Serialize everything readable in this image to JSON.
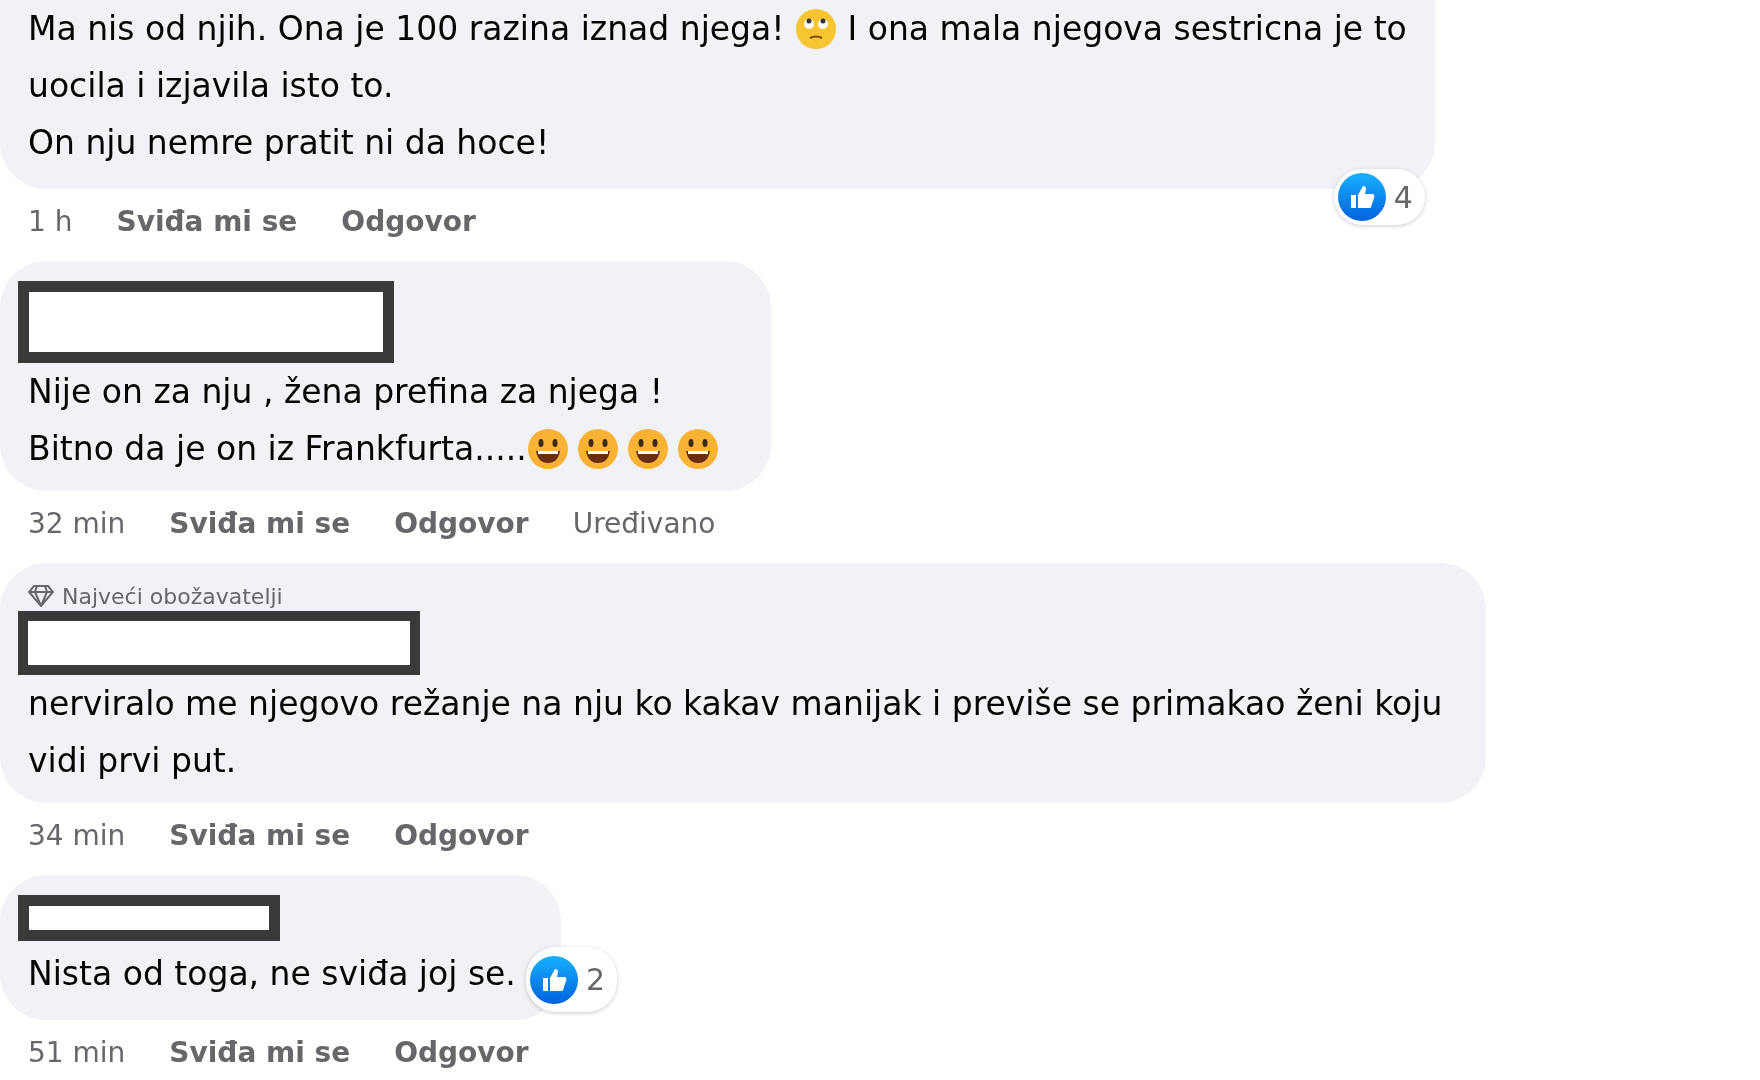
{
  "comments": [
    {
      "lines": [
        [
          {
            "kind": "text",
            "text": "Ma nis od njih. Ona je 100 razina iznad njega! "
          },
          {
            "kind": "eye_roll"
          },
          {
            "kind": "text",
            "text": " I ona mala njegova sestricna je to"
          }
        ],
        [
          {
            "kind": "text",
            "text": "uocila i izjavila isto to."
          }
        ],
        [
          {
            "kind": "text",
            "text": "On nju nemre pratit ni da hoce!"
          }
        ]
      ],
      "reaction": {
        "count": "4"
      },
      "time": "1 h",
      "actions": [
        "Sviđa mi se",
        "Odgovor"
      ]
    },
    {
      "lines": [
        [
          {
            "kind": "text",
            "text": "Nije on za nju , žena prefina za njega !"
          }
        ],
        [
          {
            "kind": "text",
            "text": "Bitno da je on iz Frankfurta....."
          },
          {
            "kind": "grin"
          },
          {
            "kind": "grin"
          },
          {
            "kind": "grin"
          },
          {
            "kind": "grin"
          }
        ]
      ],
      "time": "32 min",
      "actions": [
        "Sviđa mi se",
        "Odgovor"
      ],
      "edited": "Uređivano"
    },
    {
      "badge": "Najveći obožavatelji",
      "lines": [
        [
          {
            "kind": "text",
            "text": "nerviralo me njegovo režanje na nju ko kakav manijak i previše se primakao ženi koju"
          }
        ],
        [
          {
            "kind": "text",
            "text": "vidi prvi put."
          }
        ]
      ],
      "time": "34 min",
      "actions": [
        "Sviđa mi se",
        "Odgovor"
      ]
    },
    {
      "lines": [
        [
          {
            "kind": "text",
            "text": "Nista od toga, ne sviđa joj se."
          }
        ]
      ],
      "reaction": {
        "count": "2"
      },
      "time": "51 min",
      "actions": [
        "Sviđa mi se",
        "Odgovor"
      ]
    }
  ]
}
